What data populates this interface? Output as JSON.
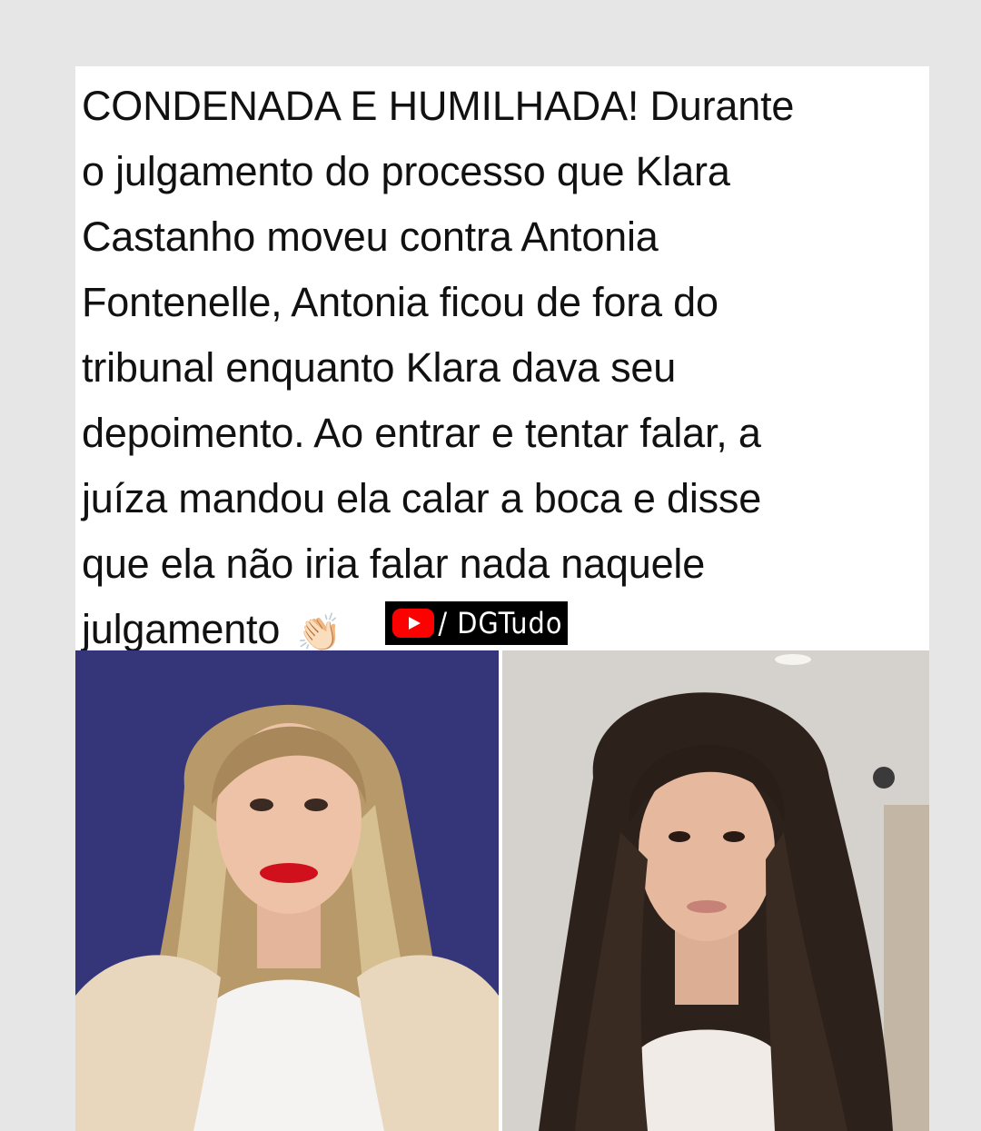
{
  "post": {
    "lines": [
      "CONDENADA E HUMILHADA! Durante",
      "o julgamento do processo que Klara",
      "Castanho moveu contra Antonia",
      "Fontenelle, Antonia ficou de fora do",
      "tribunal enquanto Klara dava seu",
      "depoimento. Ao entrar e tentar falar, a",
      "juíza mandou ela calar a boca e disse",
      "que ela não iria falar nada naquele",
      "julgamento"
    ],
    "emoji": "👏🏻",
    "emoji_icon": "clapping-hands-icon"
  },
  "channel_tag": {
    "icon": "youtube-logo-icon",
    "text": "/ DGTudo"
  },
  "photos": {
    "left_image": "blonde-woman-portrait",
    "right_image": "dark-haired-woman-portrait"
  },
  "colors": {
    "background": "#e6e6e6",
    "card": "#ffffff",
    "text": "#111111",
    "youtube_red": "#ff0000",
    "left_photo_bg": "#35367a"
  }
}
